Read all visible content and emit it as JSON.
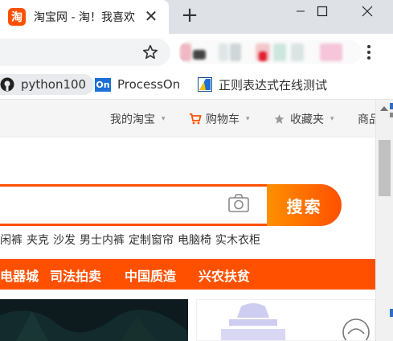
{
  "tab": {
    "favicon_char": "淘",
    "title": "淘宝网 - 淘！我喜欢",
    "close": "✕",
    "new_tab": "+"
  },
  "bookmarks": [
    {
      "label": "python100",
      "icon": "github-icon"
    },
    {
      "label": "ProcessOn",
      "icon_text": "On"
    },
    {
      "label": "正则表达式在线测试",
      "icon": "regex-icon"
    }
  ],
  "sitenav": {
    "items": [
      {
        "label": "我的淘宝",
        "caret": "▾"
      },
      {
        "label": "购物车",
        "caret": "▾"
      },
      {
        "label": "收藏夹",
        "caret": "▾"
      },
      {
        "label": "商品"
      }
    ]
  },
  "search": {
    "button_label": "搜索",
    "hotwords": [
      "闲裤",
      "夹克",
      "沙发",
      "男士内裤",
      "定制窗帘",
      "电脑椅",
      "实木衣柜"
    ]
  },
  "categories": [
    "电器城",
    "司法拍卖",
    "中国质造",
    "兴农扶贫"
  ],
  "colors": {
    "brand": "#ff5000",
    "brand_light": "#ff9000"
  }
}
